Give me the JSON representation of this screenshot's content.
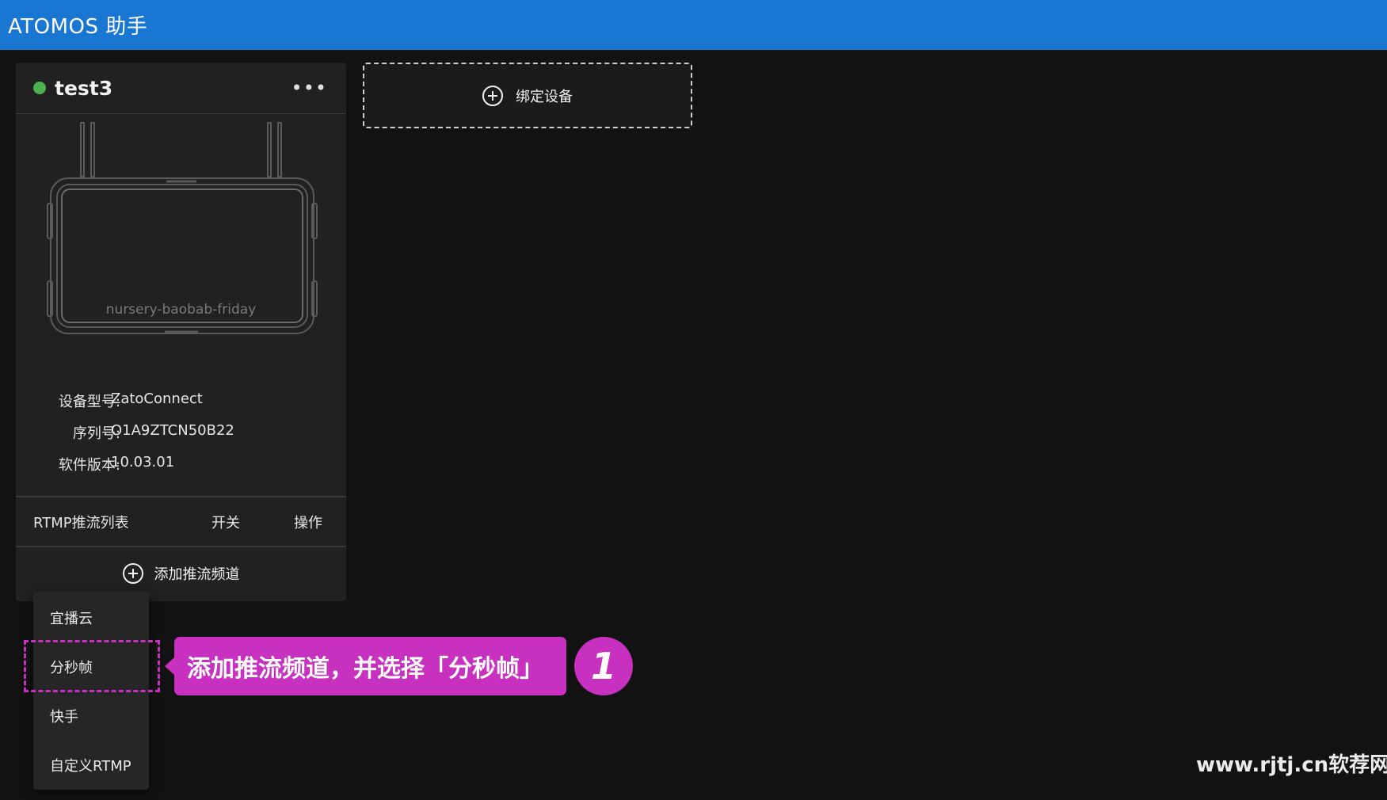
{
  "app": {
    "title": "ATOMOS 助手"
  },
  "device_card": {
    "name": "test3",
    "status_color": "#4caf50",
    "more_icon": "more-horizontal-icon",
    "more_label": "•••",
    "illustration_label": "nursery-baobab-friday",
    "info": {
      "model_label": "设备型号:",
      "model_value": "ZatoConnect",
      "serial_label": "序列号:",
      "serial_value": "O1A9ZTCN50B22",
      "firmware_label": "软件版本:",
      "firmware_value": "10.03.01"
    },
    "rtmp_table": {
      "col_list": "RTMP推流列表",
      "col_switch": "开关",
      "col_action": "操作"
    },
    "add_channel_label": "添加推流频道"
  },
  "bind_device": {
    "label": "绑定设备"
  },
  "dropdown": {
    "items": [
      "宜播云",
      "分秒帧",
      "快手",
      "自定义RTMP"
    ],
    "highlighted": "分秒帧"
  },
  "annotation": {
    "callout_text": "添加推流频道，并选择「分秒帧」",
    "step_number": "1",
    "accent_color": "#c830c0"
  },
  "watermark": {
    "text": "www.rjtj.cn软荐网"
  },
  "colors": {
    "topbar": "#1976d2",
    "background": "#121212",
    "card": "#212121"
  }
}
